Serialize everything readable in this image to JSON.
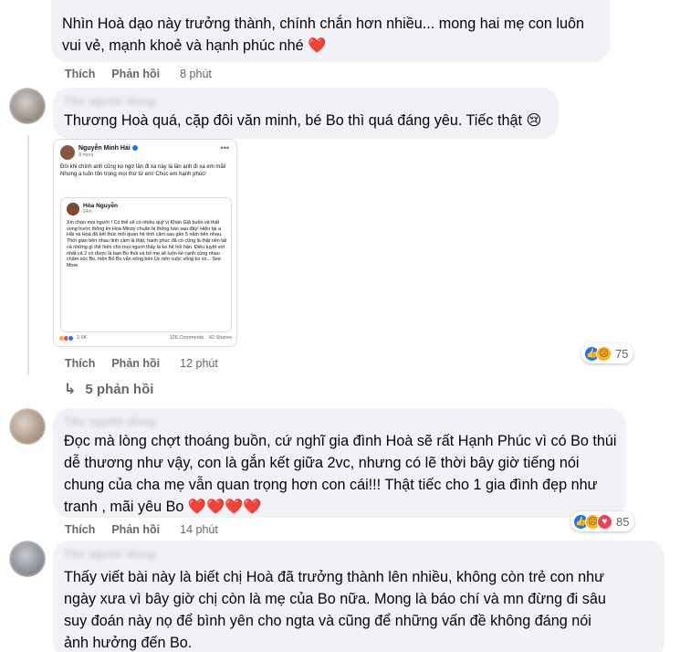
{
  "comments": [
    {
      "text": "Nhìn Hoà dạo này trưởng thành, chính chắn hơn nhiều... mong hai mẹ con luôn vui vẻ, mạnh khoẻ và hạnh phúc nhé",
      "emoji": "❤️",
      "like_label": "Thích",
      "reply_label": "Phản hồi",
      "time": "8 phút"
    },
    {
      "author": "Tên người dùng",
      "text": "Thương Hoà quá, cặp đôi văn minh, bé Bo thì quá đáng yêu. Tiếc thật",
      "emoji": "😢",
      "like_label": "Thích",
      "reply_label": "Phản hồi",
      "time": "12 phút",
      "reaction_count": "75",
      "replies_label": "5 phản hồi"
    },
    {
      "author": "Tên người dùng",
      "text_lines": [
        "Đọc mà lòng chợt thoáng buồn, cứ nghĩ gia đình Hoà sẽ rất Hạnh Phúc vì có Bo thúi",
        "dễ thương như vậy, con là gắn kết giữa 2vc, nhưng có lẽ thời bây giờ tiếng nói",
        "chung của cha mẹ vẫn quan trọng hơn con cái!!! Thật tiếc cho 1 gia đình đẹp như",
        "tranh , mãi yêu Bo"
      ],
      "emoji": "❤️❤️❤️❤️",
      "like_label": "Thích",
      "reply_label": "Phản hồi",
      "time": "14 phút",
      "reaction_count": "85"
    },
    {
      "author": "Tên người dùng",
      "text_lines": [
        "Thấy viết bài này là biết chị Hoà đã trưởng thành lên nhiều, không còn trẻ con như",
        "ngày xưa vì bây giờ chị còn là mẹ của Bo nữa. Mong là báo chí và mn đừng đi sâu",
        "suy đoán này nọ để bình yên cho ngta và cũng để những vấn đề không đáng nói",
        "ảnh hưởng đến Bo."
      ]
    }
  ],
  "shot": {
    "name": "Nguyễn Minh Hải",
    "time": "8 mins",
    "post": "Đôi khi chính anh cũng ko ngờ lần đi xa này là lần anh đi xa em mãi! Nhưng a luôn tôn trọng mọi thứ từ em! Chúc em hạnh phúc!",
    "inner_name": "Hòa Nguyễn",
    "inner_time": "24m",
    "inner_body": "Xin chào mọi người ! Có thể sẽ có nhiều quý vị Khán Giả buồn và thất vọng trước thông tin Hoà Minzy chuẩn bị thông báo sau đây! Hiện tại a Hải và Hoà đã kết thúc mối quan hệ tình cảm sau gần 5 năm bên nhau. Thời gian bên nhau tình cảm là thật, hạnh phúc đã có cũng là thật nên tất cả những gì thể hiện cho mọi người thấy là ko hề hối hận. Điều tuyệt vời nhất cả 2 có được là bạn Bo thúi và bố mẹ sẽ luôn kề cạnh cùng nhau chăm sóc Bo, hiện Bố Bo vẫn sống bên Úc nên cuộc sống ko có... See More",
    "reactions": "2.6K",
    "comments": "126 Comments",
    "shares": "42 Shares"
  },
  "icons": {
    "like": "like-reaction-icon",
    "sad": "sad-reaction-icon",
    "love": "love-reaction-icon",
    "reply_arrow": "reply-arrow-icon"
  },
  "colors": {
    "bubble": "#f0f2f5",
    "meta": "#65676b",
    "like": "#1877f2"
  }
}
